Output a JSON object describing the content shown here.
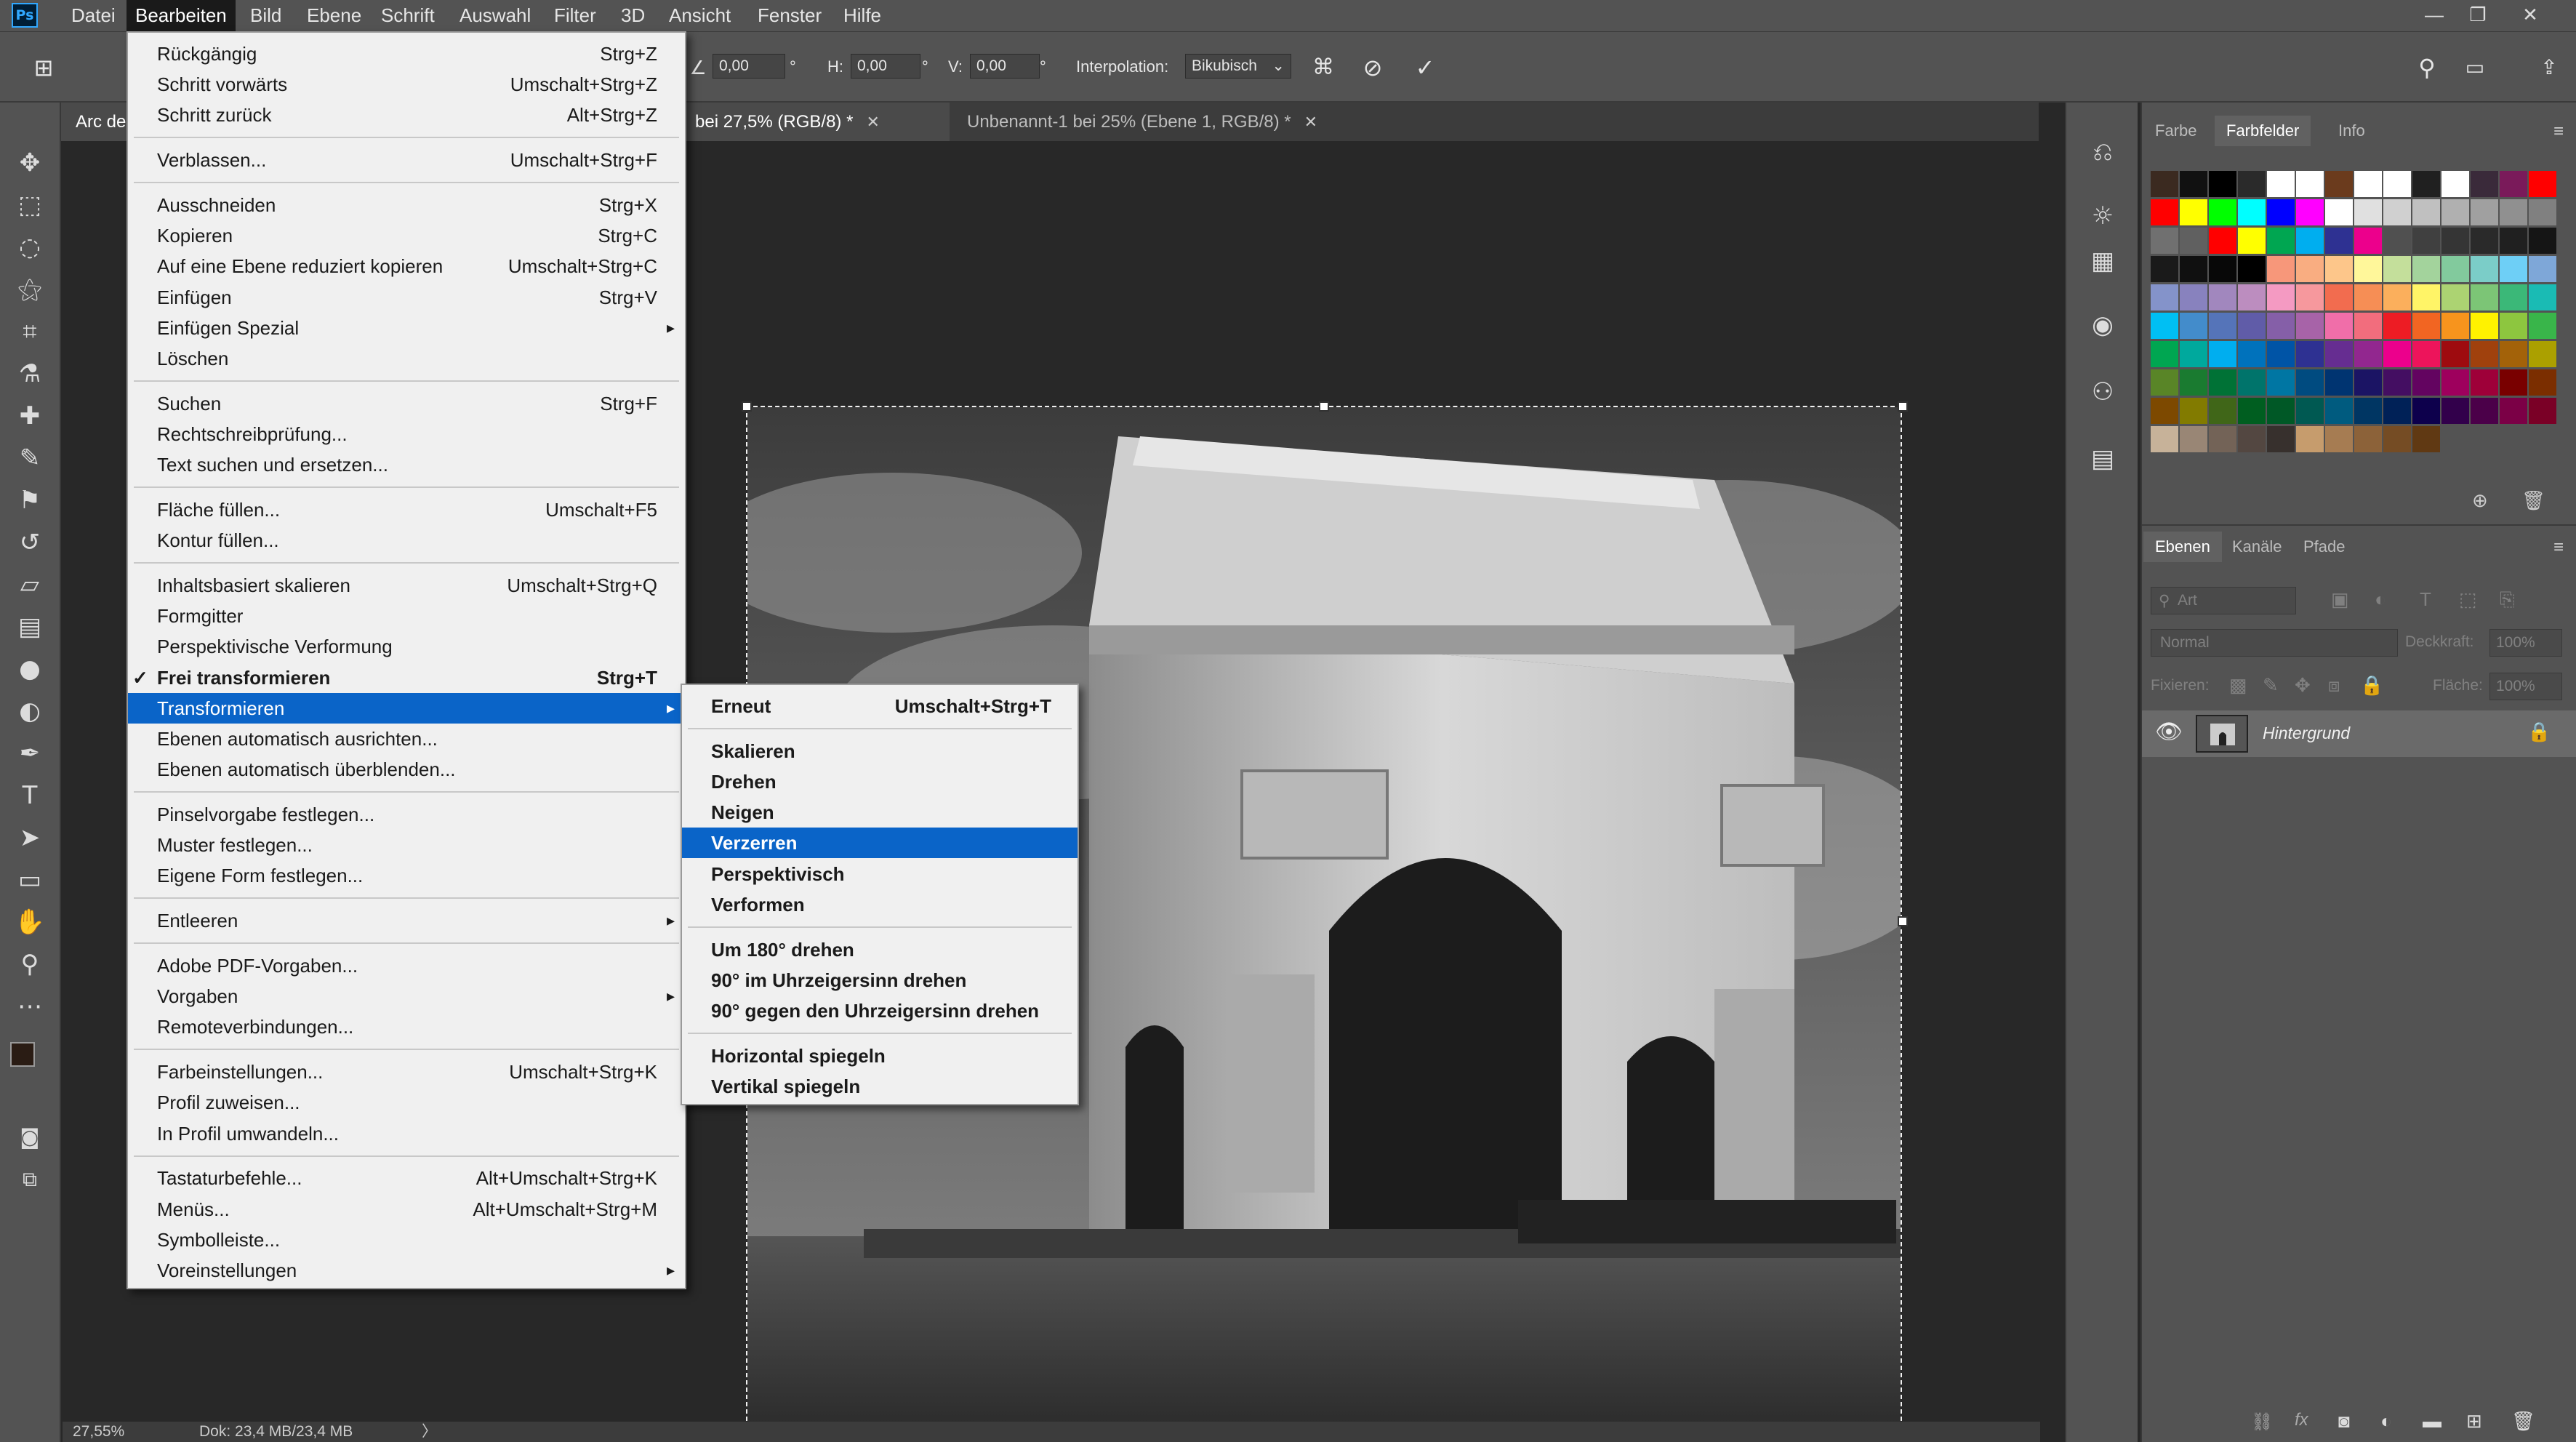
{
  "app": {
    "logo": "Ps"
  },
  "menubar": {
    "items": [
      "Datei",
      "Bearbeiten",
      "Bild",
      "Ebene",
      "Schrift",
      "Auswahl",
      "Filter",
      "3D",
      "Ansicht",
      "Fenster",
      "Hilfe"
    ],
    "window_controls": [
      "—",
      "❐",
      "✕"
    ]
  },
  "options": {
    "angle_value": "0,00",
    "angle_unit": "°",
    "h_label": "H:",
    "h_value": "0,00",
    "h_unit": "°",
    "v_label": "V:",
    "v_value": "0,00",
    "v_unit": "°",
    "interp_label": "Interpolation:",
    "interp_value": "Bikubisch",
    "commit_icon": "✓",
    "cancel_icon": "⃠"
  },
  "tabs": [
    {
      "label": "Arc de",
      "active": true
    },
    {
      "label": "bei 27,5% (RGB/8) *",
      "active": true,
      "close": "✕"
    },
    {
      "label": "Unbenannt-1 bei 25% (Ebene 1, RGB/8) *",
      "active": false,
      "close": "✕"
    }
  ],
  "status": {
    "zoom": "27,55%",
    "doc": "Dok: 23,4 MB/23,4 MB",
    "arrow": "〉"
  },
  "edit_menu": [
    {
      "label": "Rückgängig",
      "shortcut": "Strg+Z"
    },
    {
      "label": "Schritt vorwärts",
      "shortcut": "Umschalt+Strg+Z"
    },
    {
      "label": "Schritt zurück",
      "shortcut": "Alt+Strg+Z"
    },
    {
      "sep": true
    },
    {
      "label": "Verblassen...",
      "shortcut": "Umschalt+Strg+F"
    },
    {
      "sep": true
    },
    {
      "label": "Ausschneiden",
      "shortcut": "Strg+X"
    },
    {
      "label": "Kopieren",
      "shortcut": "Strg+C"
    },
    {
      "label": "Auf eine Ebene reduziert kopieren",
      "shortcut": "Umschalt+Strg+C"
    },
    {
      "label": "Einfügen",
      "shortcut": "Strg+V"
    },
    {
      "label": "Einfügen Spezial",
      "submenu": true
    },
    {
      "label": "Löschen"
    },
    {
      "sep": true
    },
    {
      "label": "Suchen",
      "shortcut": "Strg+F"
    },
    {
      "label": "Rechtschreibprüfung..."
    },
    {
      "label": "Text suchen und ersetzen..."
    },
    {
      "sep": true
    },
    {
      "label": "Fläche füllen...",
      "shortcut": "Umschalt+F5"
    },
    {
      "label": "Kontur füllen..."
    },
    {
      "sep": true
    },
    {
      "label": "Inhaltsbasiert skalieren",
      "shortcut": "Umschalt+Strg+Q"
    },
    {
      "label": "Formgitter"
    },
    {
      "label": "Perspektivische Verformung"
    },
    {
      "label": "Frei transformieren",
      "shortcut": "Strg+T",
      "checked": true
    },
    {
      "label": "Transformieren",
      "submenu": true,
      "selected": true
    },
    {
      "label": "Ebenen automatisch ausrichten..."
    },
    {
      "label": "Ebenen automatisch überblenden..."
    },
    {
      "sep": true
    },
    {
      "label": "Pinselvorgabe festlegen..."
    },
    {
      "label": "Muster festlegen..."
    },
    {
      "label": "Eigene Form festlegen..."
    },
    {
      "sep": true
    },
    {
      "label": "Entleeren",
      "submenu": true
    },
    {
      "sep": true
    },
    {
      "label": "Adobe PDF-Vorgaben..."
    },
    {
      "label": "Vorgaben",
      "submenu": true
    },
    {
      "label": "Remoteverbindungen..."
    },
    {
      "sep": true
    },
    {
      "label": "Farbeinstellungen...",
      "shortcut": "Umschalt+Strg+K"
    },
    {
      "label": "Profil zuweisen..."
    },
    {
      "label": "In Profil umwandeln..."
    },
    {
      "sep": true
    },
    {
      "label": "Tastaturbefehle...",
      "shortcut": "Alt+Umschalt+Strg+K"
    },
    {
      "label": "Menüs...",
      "shortcut": "Alt+Umschalt+Strg+M"
    },
    {
      "label": "Symbolleiste..."
    },
    {
      "label": "Voreinstellungen",
      "submenu": true
    }
  ],
  "transform_menu": [
    {
      "label": "Erneut",
      "shortcut": "Umschalt+Strg+T"
    },
    {
      "sep": true
    },
    {
      "label": "Skalieren"
    },
    {
      "label": "Drehen"
    },
    {
      "label": "Neigen"
    },
    {
      "label": "Verzerren",
      "selected": true
    },
    {
      "label": "Perspektivisch"
    },
    {
      "label": "Verformen"
    },
    {
      "sep": true
    },
    {
      "label": "Um 180° drehen"
    },
    {
      "label": "90° im Uhrzeigersinn drehen"
    },
    {
      "label": "90° gegen den Uhrzeigersinn drehen"
    },
    {
      "sep": true
    },
    {
      "label": "Horizontal spiegeln"
    },
    {
      "label": "Vertikal spiegeln"
    }
  ],
  "color_panel": {
    "tabs": [
      "Farbe",
      "Farbfelder",
      "Info"
    ],
    "active_tab": "Farbfelder",
    "swatch_rows": [
      [
        "#3b2a20",
        "#111111",
        "#000000",
        "#2a2a2a",
        "#ffffff",
        "#ffffff",
        "#6b3b1d",
        "#ffffff",
        "#ffffff",
        "#202020",
        "#ffffff",
        "#3a2a3a",
        "#7a1a5a",
        "#ff0000"
      ],
      [
        "#ff0000",
        "#ffff00",
        "#00ff00",
        "#00ffff",
        "#0000ff",
        "#ff00ff",
        "#ffffff",
        "#e0e0e0",
        "#d0d0d0",
        "#c0c0c0",
        "#b0b0b0",
        "#a0a0a0",
        "#909090",
        "#808080"
      ],
      [
        "#707070",
        "#606060",
        "#ff0000",
        "#ffff00",
        "#00a651",
        "#00aeef",
        "#2e3192",
        "#ec008c",
        "#505050",
        "#404040",
        "#353535",
        "#2a2a2a",
        "#202020",
        "#151515"
      ],
      [
        "#1a1a1a",
        "#101010",
        "#080808",
        "#000000",
        "#f7977a",
        "#f9ad81",
        "#fdc68a",
        "#fff79a",
        "#c4df9b",
        "#a3d39c",
        "#82ca9d",
        "#7bcdc8",
        "#6ecff6",
        "#7ea7d8"
      ],
      [
        "#8493ca",
        "#8882be",
        "#a187be",
        "#bc8dbf",
        "#f49ac2",
        "#f6989d",
        "#f26c4f",
        "#f68e55",
        "#fbaf5c",
        "#fff467",
        "#acd372",
        "#7cc576",
        "#3bb878",
        "#1abbb4"
      ],
      [
        "#00bff3",
        "#438ccb",
        "#5574b9",
        "#605ca8",
        "#855fa8",
        "#a763a8",
        "#f06ea9",
        "#f26d7d",
        "#ed1c24",
        "#f26522",
        "#f7941d",
        "#fff200",
        "#8dc63f",
        "#39b54a"
      ],
      [
        "#00a651",
        "#00a99d",
        "#00aeef",
        "#0072bc",
        "#0054a6",
        "#2e3192",
        "#662d91",
        "#92278f",
        "#ec008c",
        "#ed145b",
        "#9e0b0f",
        "#a0410d",
        "#a36209",
        "#aba000"
      ],
      [
        "#598527",
        "#1a7b30",
        "#007236",
        "#00746b",
        "#0076a3",
        "#004b80",
        "#003471",
        "#1b1464",
        "#440e62",
        "#630460",
        "#9e005d",
        "#9e0039",
        "#790000",
        "#7b2e00"
      ],
      [
        "#7d4900",
        "#827b00",
        "#406618",
        "#005e20",
        "#005826",
        "#005952",
        "#005b7f",
        "#003663",
        "#002157",
        "#0d004c",
        "#32004b",
        "#4b0049",
        "#7b0046",
        "#7a0026"
      ],
      [
        "#c7b299",
        "#998675",
        "#736357",
        "#534741",
        "#37302d",
        "#c69c6d",
        "#a67c52",
        "#8c6239",
        "#754c24",
        "#603913",
        "#0000",
        "#0000",
        "#0000",
        "#0000"
      ]
    ]
  },
  "layers_panel": {
    "tabs": [
      "Ebenen",
      "Kanäle",
      "Pfade"
    ],
    "active_tab": "Ebenen",
    "filter_placeholder": "Art",
    "blend_mode": "Normal",
    "opacity_label": "Deckkraft:",
    "opacity_value": "100%",
    "lock_label": "Fixieren:",
    "fill_label": "Fläche:",
    "fill_value": "100%",
    "layer_name": "Hintergrund"
  },
  "colors": {
    "accent": "#0a64c8",
    "bg": "#282828",
    "panel": "#535353"
  }
}
